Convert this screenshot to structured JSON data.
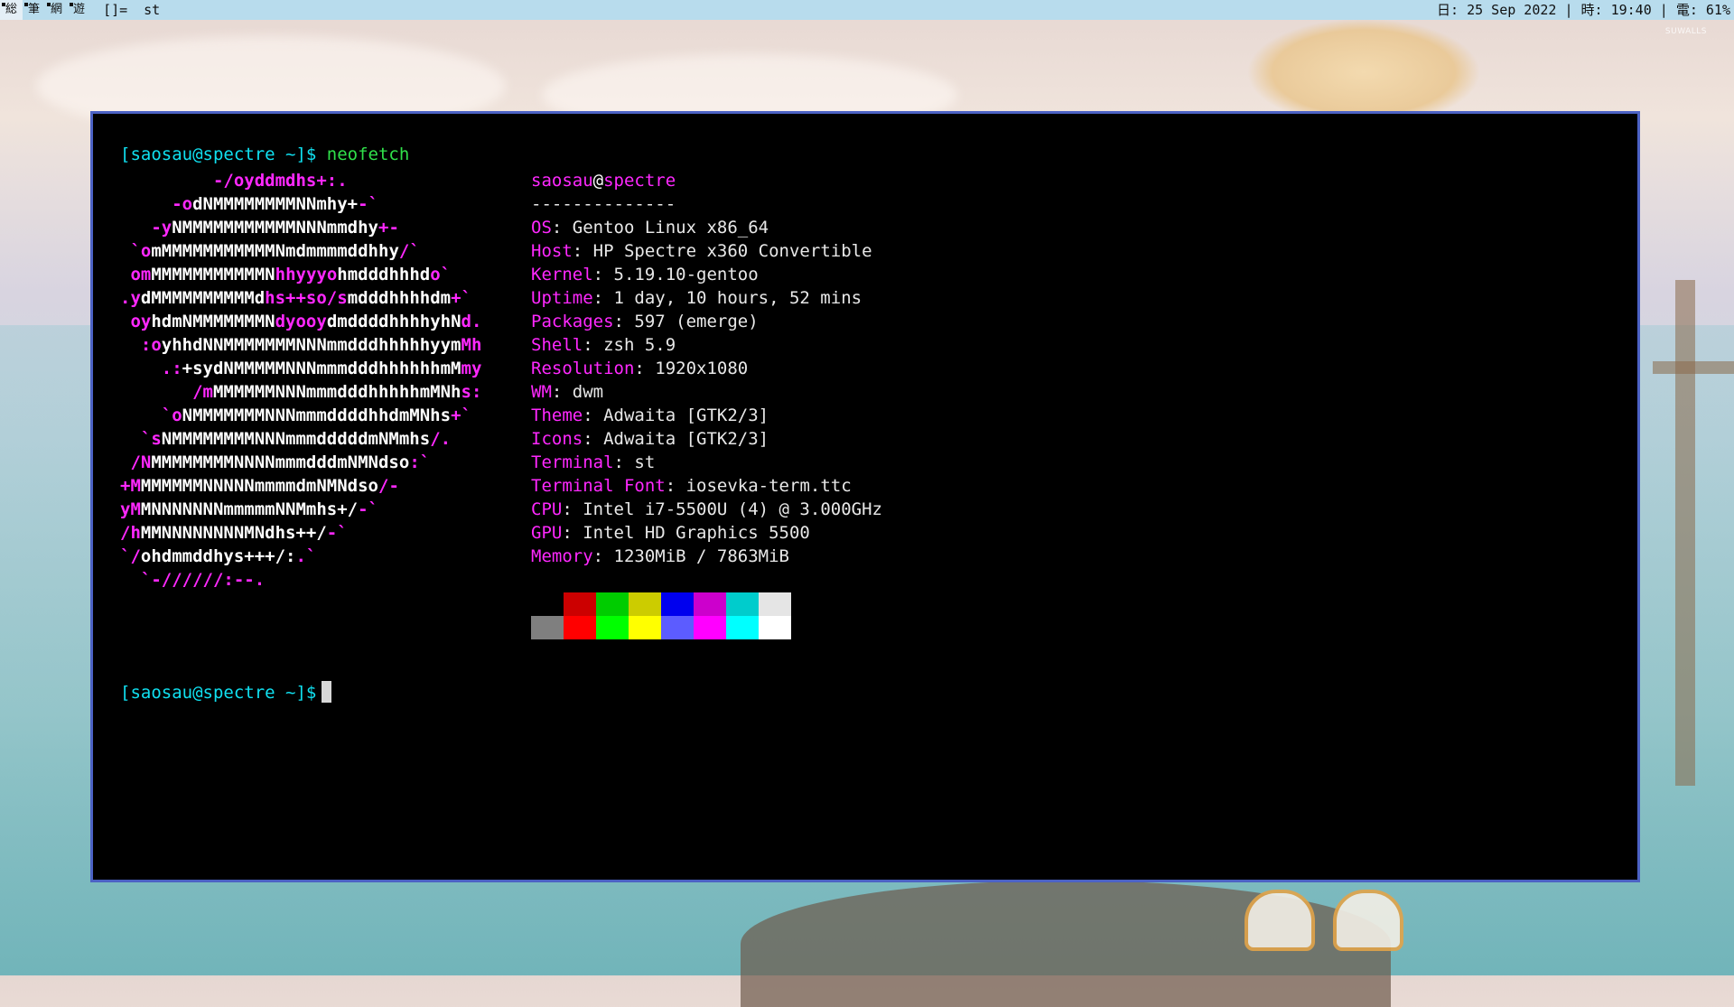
{
  "bar": {
    "tags": [
      {
        "label": "総",
        "active": true
      },
      {
        "label": "筆",
        "active": false
      },
      {
        "label": "網",
        "active": false
      },
      {
        "label": "遊",
        "active": false
      }
    ],
    "layout_symbol": "[]=",
    "window_title": "st",
    "status": "日: 25 Sep 2022 | 時: 19:40 | 電: 61%"
  },
  "wallpaper": {
    "watermark": "SUWALLS"
  },
  "terminal": {
    "prompt": "[saosau@spectre ~]$",
    "command": "neofetch",
    "logo_lines": [
      [
        [
          "         ",
          ""
        ],
        [
          "-/oyddmdhs+:.",
          "m"
        ]
      ],
      [
        [
          "     ",
          ""
        ],
        [
          "-o",
          "m"
        ],
        [
          "dNMMMMMMMMNNmhy+",
          "w"
        ],
        [
          "-`",
          "m"
        ]
      ],
      [
        [
          "   ",
          ""
        ],
        [
          "-y",
          "m"
        ],
        [
          "NMMMMMMMMMMMNNNmmdhy",
          "w"
        ],
        [
          "+-",
          "m"
        ]
      ],
      [
        [
          " `",
          "m"
        ],
        [
          "o",
          "m"
        ],
        [
          "mMMMMMMMMMMMNmdmmmmddhhy",
          "w"
        ],
        [
          "/`",
          "m"
        ]
      ],
      [
        [
          " ",
          ""
        ],
        [
          "om",
          "m"
        ],
        [
          "MMMMMMMMMMMN",
          "w"
        ],
        [
          "hhyyyo",
          "m"
        ],
        [
          "hmdddhhhd",
          "w"
        ],
        [
          "o`",
          "m"
        ]
      ],
      [
        [
          ".y",
          "m"
        ],
        [
          "dMMMMMMMMMMd",
          "w"
        ],
        [
          "hs++so/s",
          "m"
        ],
        [
          "mdddhhhhdm",
          "w"
        ],
        [
          "+`",
          "m"
        ]
      ],
      [
        [
          " oy",
          "m"
        ],
        [
          "hdmNMMMMMMMN",
          "w"
        ],
        [
          "dyooy",
          "m"
        ],
        [
          "dmddddhhhhyhN",
          "w"
        ],
        [
          "d.",
          "m"
        ]
      ],
      [
        [
          "  :o",
          "m"
        ],
        [
          "yhhdNNMMMMMMMNNNmmdddhhhhhyym",
          "w"
        ],
        [
          "Mh",
          "m"
        ]
      ],
      [
        [
          "    .:",
          "m"
        ],
        [
          "+sydNMMMMMNNNmmmdddhhhhhhmM",
          "w"
        ],
        [
          "my",
          "m"
        ]
      ],
      [
        [
          "       /m",
          "m"
        ],
        [
          "MMMMMMNNNmmmdddhhhhhmMNh",
          "w"
        ],
        [
          "s:",
          "m"
        ]
      ],
      [
        [
          "    `o",
          "m"
        ],
        [
          "NMMMMMMMNNNmmmddddhhdmMNhs",
          "w"
        ],
        [
          "+`",
          "m"
        ]
      ],
      [
        [
          "  `s",
          "m"
        ],
        [
          "NMMMMMMMMNNNmmmdddddmNMmhs",
          "w"
        ],
        [
          "/.",
          "m"
        ]
      ],
      [
        [
          " /N",
          "m"
        ],
        [
          "MMMMMMMMNNNNmmmdddmNMNdso",
          "w"
        ],
        [
          ":`",
          "m"
        ]
      ],
      [
        [
          "+M",
          "m"
        ],
        [
          "MMMMMMNNNNNmmmmdmNMNdso",
          "w"
        ],
        [
          "/-",
          "m"
        ]
      ],
      [
        [
          "yM",
          "m"
        ],
        [
          "MNNNNNNNmmmmmNNMmhs+/",
          "w"
        ],
        [
          "-`",
          "m"
        ]
      ],
      [
        [
          "/h",
          "m"
        ],
        [
          "MMNNNNNNNNMNdhs++/",
          "w"
        ],
        [
          "-`",
          "m"
        ]
      ],
      [
        [
          "`/",
          "m"
        ],
        [
          "ohdmmddhys+++/:",
          "w"
        ],
        [
          ".`",
          "m"
        ]
      ],
      [
        [
          "  `-//////:--.",
          "m"
        ]
      ]
    ],
    "user": "saosau",
    "host": "spectre",
    "separator": "--------------",
    "info": [
      {
        "key": "OS",
        "value": "Gentoo Linux x86_64"
      },
      {
        "key": "Host",
        "value": "HP Spectre x360 Convertible"
      },
      {
        "key": "Kernel",
        "value": "5.19.10-gentoo"
      },
      {
        "key": "Uptime",
        "value": "1 day, 10 hours, 52 mins"
      },
      {
        "key": "Packages",
        "value": "597 (emerge)"
      },
      {
        "key": "Shell",
        "value": "zsh 5.9"
      },
      {
        "key": "Resolution",
        "value": "1920x1080"
      },
      {
        "key": "WM",
        "value": "dwm"
      },
      {
        "key": "Theme",
        "value": "Adwaita [GTK2/3]"
      },
      {
        "key": "Icons",
        "value": "Adwaita [GTK2/3]"
      },
      {
        "key": "Terminal",
        "value": "st"
      },
      {
        "key": "Terminal Font",
        "value": "iosevka-term.ttc"
      },
      {
        "key": "CPU",
        "value": "Intel i7-5500U (4) @ 3.000GHz"
      },
      {
        "key": "GPU",
        "value": "Intel HD Graphics 5500"
      },
      {
        "key": "Memory",
        "value": "1230MiB / 7863MiB"
      }
    ],
    "colors_top": [
      "#000000",
      "#cc0000",
      "#00cc00",
      "#cccc00",
      "#0000ee",
      "#cc00cc",
      "#00cccc",
      "#e5e5e5"
    ],
    "colors_bottom": [
      "#7f7f7f",
      "#ff0000",
      "#00ff00",
      "#ffff00",
      "#5c5cff",
      "#ff00ff",
      "#00ffff",
      "#ffffff"
    ]
  }
}
